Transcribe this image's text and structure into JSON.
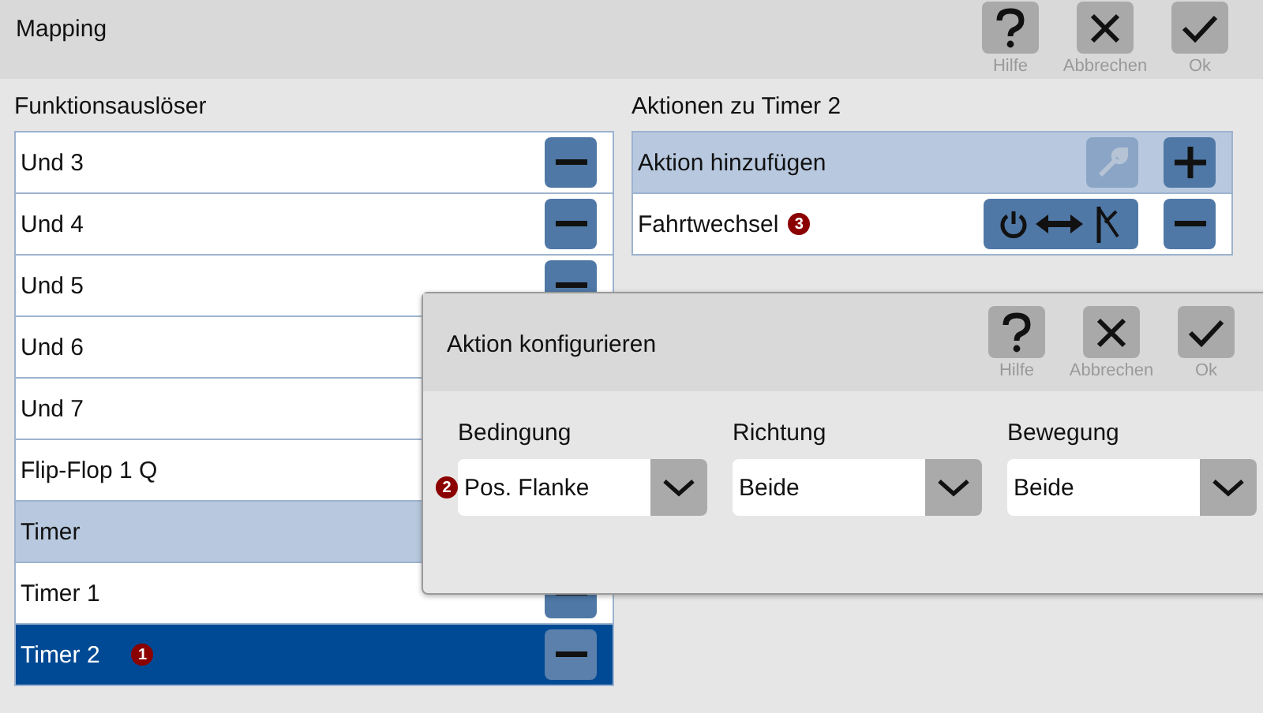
{
  "window": {
    "title": "Mapping"
  },
  "toolbar": [
    {
      "kind": "help",
      "label": "Hilfe"
    },
    {
      "kind": "cancel",
      "label": "Abbrechen"
    },
    {
      "kind": "ok",
      "label": "Ok"
    }
  ],
  "triggers": {
    "heading": "Funktionsauslöser",
    "items": [
      {
        "kind": "item",
        "label": "Und 3",
        "selected": false,
        "remove_button": true
      },
      {
        "kind": "item",
        "label": "Und 4",
        "selected": false,
        "remove_button": true
      },
      {
        "kind": "item",
        "label": "Und 5",
        "selected": false,
        "remove_button": true
      },
      {
        "kind": "item",
        "label": "Und 6",
        "selected": false,
        "remove_button": false
      },
      {
        "kind": "item",
        "label": "Und 7",
        "selected": false,
        "remove_button": false
      },
      {
        "kind": "item",
        "label": "Flip-Flop 1 Q",
        "selected": false,
        "remove_button": false
      },
      {
        "kind": "group",
        "label": "Timer",
        "selected": false,
        "remove_button": false
      },
      {
        "kind": "item",
        "label": "Timer 1",
        "selected": false,
        "remove_button": true
      },
      {
        "kind": "item",
        "label": "Timer 2",
        "selected": true,
        "remove_button": true,
        "badge": "1"
      }
    ]
  },
  "actions": {
    "heading": "Aktionen zu Timer 2",
    "add_row": {
      "label": "Aktion hinzufügen",
      "edit_disabled": true
    },
    "items": [
      {
        "label": "Fahrtwechsel",
        "badge": "3"
      }
    ]
  },
  "dialog": {
    "title": "Aktion konfigurieren",
    "toolbar": [
      {
        "kind": "help",
        "label": "Hilfe"
      },
      {
        "kind": "cancel",
        "label": "Abbrechen"
      },
      {
        "kind": "ok",
        "label": "Ok"
      }
    ],
    "fields": [
      {
        "label": "Bedingung",
        "value": "Pos. Flanke",
        "badge": "2"
      },
      {
        "label": "Richtung",
        "value": "Beide"
      },
      {
        "label": "Bewegung",
        "value": "Beide"
      }
    ]
  }
}
